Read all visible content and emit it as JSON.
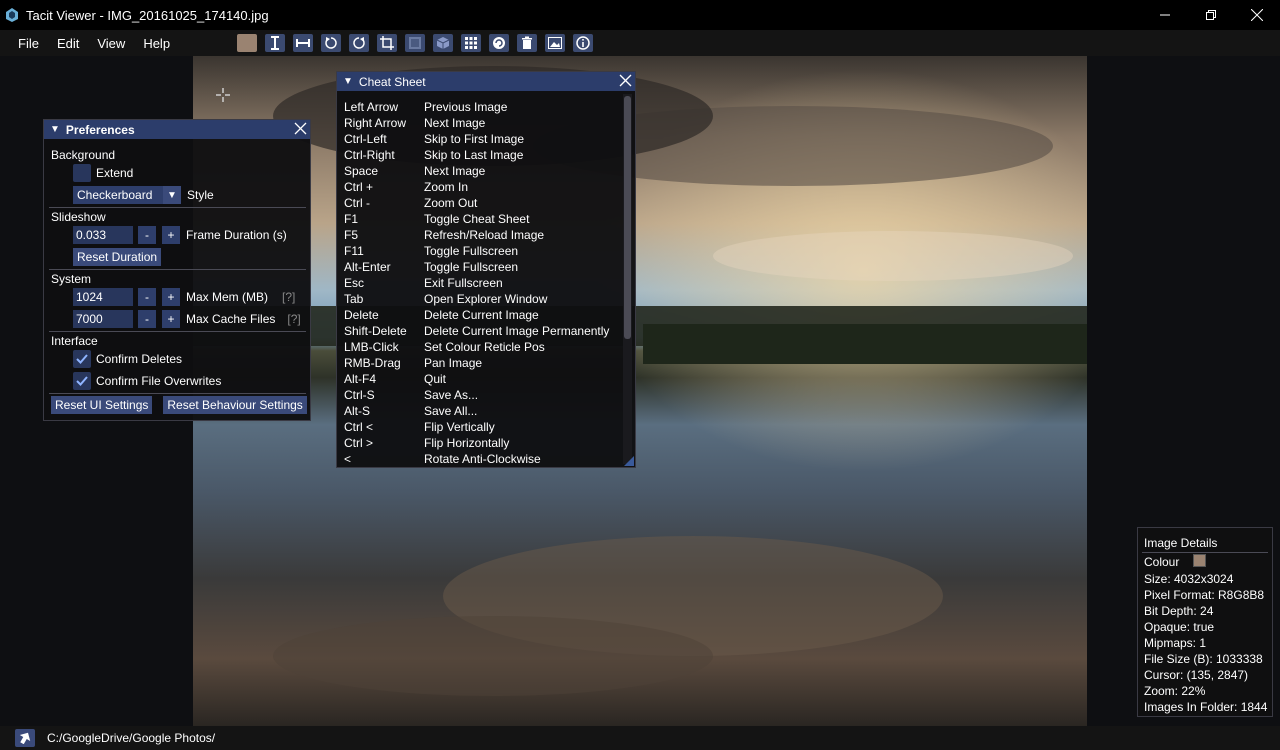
{
  "window": {
    "title": "Tacit Viewer - IMG_20161025_174140.jpg",
    "controls": [
      "minimize-icon",
      "restore-icon",
      "close-icon"
    ]
  },
  "menu": {
    "items": [
      "File",
      "Edit",
      "View",
      "Help"
    ]
  },
  "toolbar": {
    "tools": [
      "colour-swatch",
      "fit-height-icon",
      "fit-width-icon",
      "rotate-anticlockwise-icon",
      "rotate-clockwise-icon",
      "crop-icon",
      "tile-icon",
      "cube-icon",
      "grid-icon",
      "refresh-icon",
      "delete-icon",
      "image-icon",
      "info-icon"
    ],
    "swatch_color": "#9a8371"
  },
  "preferences": {
    "title": "Preferences",
    "background_label": "Background",
    "extend_label": "Extend",
    "style_value": "Checkerboard",
    "style_label": "Style",
    "slideshow_label": "Slideshow",
    "frame_duration_value": "0.033",
    "frame_duration_label": "Frame Duration (s)",
    "minus": "-",
    "plus": "+",
    "reset_duration_label": "Reset Duration",
    "system_label": "System",
    "max_mem_value": "1024",
    "max_mem_label": "Max Mem (MB)",
    "max_cache_value": "7000",
    "max_cache_label": "Max Cache Files",
    "help_marker": "[?]",
    "interface_label": "Interface",
    "confirm_deletes_label": "Confirm Deletes",
    "confirm_overwrites_label": "Confirm File Overwrites",
    "reset_ui_label": "Reset UI Settings",
    "reset_behaviour_label": "Reset Behaviour Settings"
  },
  "cheat_sheet": {
    "title": "Cheat Sheet",
    "rows": [
      {
        "key": "Left Arrow",
        "action": "Previous Image"
      },
      {
        "key": "Right Arrow",
        "action": "Next Image"
      },
      {
        "key": "Ctrl-Left",
        "action": "Skip to First Image"
      },
      {
        "key": "Ctrl-Right",
        "action": "Skip to Last Image"
      },
      {
        "key": "Space",
        "action": "Next Image"
      },
      {
        "key": "Ctrl +",
        "action": "Zoom In"
      },
      {
        "key": "Ctrl -",
        "action": "Zoom Out"
      },
      {
        "key": "F1",
        "action": "Toggle Cheat Sheet"
      },
      {
        "key": "F5",
        "action": "Refresh/Reload Image"
      },
      {
        "key": "F11",
        "action": "Toggle Fullscreen"
      },
      {
        "key": "Alt-Enter",
        "action": "Toggle Fullscreen"
      },
      {
        "key": "Esc",
        "action": "Exit Fullscreen"
      },
      {
        "key": "Tab",
        "action": "Open Explorer Window"
      },
      {
        "key": "Delete",
        "action": "Delete Current Image"
      },
      {
        "key": "Shift-Delete",
        "action": "Delete Current Image Permanently"
      },
      {
        "key": "LMB-Click",
        "action": "Set Colour Reticle Pos"
      },
      {
        "key": "RMB-Drag",
        "action": "Pan Image"
      },
      {
        "key": "Alt-F4",
        "action": "Quit"
      },
      {
        "key": "Ctrl-S",
        "action": "Save As..."
      },
      {
        "key": "Alt-S",
        "action": "Save All..."
      },
      {
        "key": "Ctrl <",
        "action": "Flip Vertically"
      },
      {
        "key": "Ctrl >",
        "action": "Flip Horizontally"
      },
      {
        "key": "<",
        "action": "Rotate Anti-Clockwise"
      }
    ]
  },
  "image_details": {
    "title": "Image Details",
    "colour_label": "Colour",
    "colour_value": "#9a8371",
    "size": "Size: 4032x3024",
    "pixel_format": "Pixel Format: R8G8B8",
    "bit_depth": "Bit Depth: 24",
    "opaque": "Opaque: true",
    "mipmaps": "Mipmaps: 1",
    "file_size": "File Size (B): 1033338",
    "cursor": "Cursor: (135, 2847)",
    "zoom": "Zoom: 22%",
    "images_in_folder": "Images In Folder: 1844"
  },
  "status": {
    "path": "C:/GoogleDrive/Google Photos/"
  }
}
